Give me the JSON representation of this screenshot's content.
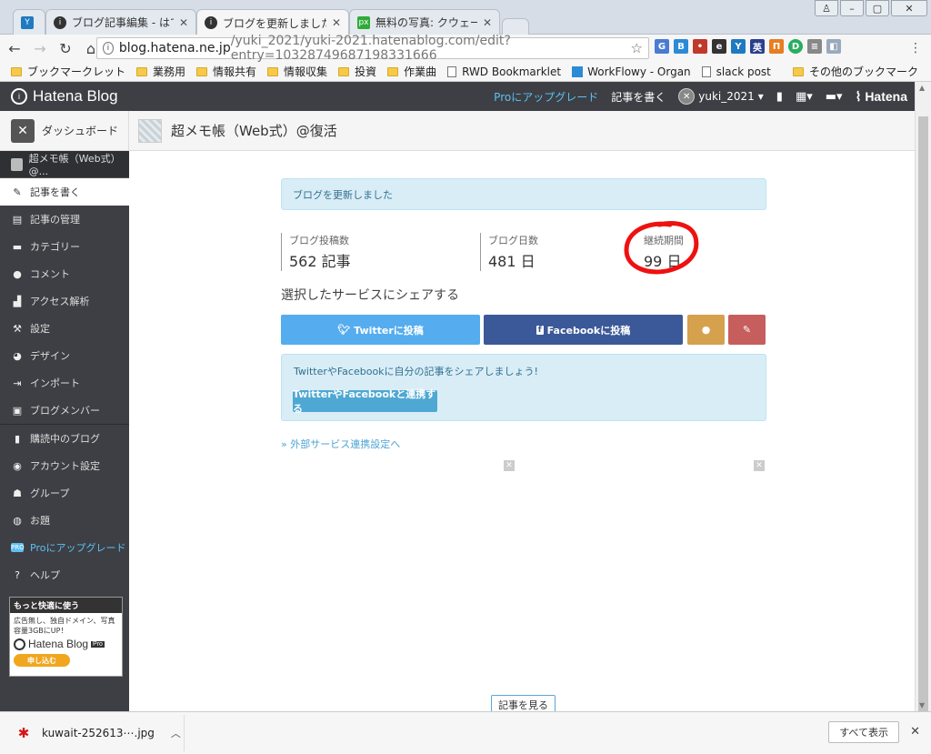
{
  "browser": {
    "tabs": [
      {
        "title": "",
        "icon": "hatena-icon",
        "color": "#1f7ac0"
      },
      {
        "title": "ブログ記事編集 - はてな",
        "icon": "hatena-blog-icon",
        "color": "#333333"
      },
      {
        "title": "ブログを更新しました -",
        "icon": "hatena-blog-icon",
        "color": "#333333"
      },
      {
        "title": "無料の写真: クウェート",
        "icon": "pixabay-icon",
        "color": "#2eab38"
      }
    ],
    "url_host": "blog.hatena.ne.jp",
    "url_path": "/yuki_2021/yuki-2021.hatenablog.com/edit?entry=10328749687198331666",
    "bookmarks": [
      {
        "label": "ブックマークレット",
        "type": "folder"
      },
      {
        "label": "業務用",
        "type": "folder"
      },
      {
        "label": "情報共有",
        "type": "folder"
      },
      {
        "label": "情報収集",
        "type": "folder"
      },
      {
        "label": "投資",
        "type": "folder"
      },
      {
        "label": "作業曲",
        "type": "folder"
      },
      {
        "label": "RWD Bookmarklet",
        "type": "page"
      },
      {
        "label": "WorkFlowy - Organ",
        "type": "workflowy"
      },
      {
        "label": "slack post",
        "type": "page"
      }
    ],
    "bookmarks_other": "その他のブックマーク"
  },
  "hatena_bar": {
    "logo": "Hatena Blog",
    "pro_upgrade": "Proにアップグレード",
    "write_post": "記事を書く",
    "username": "yuki_2021",
    "brand": "Hatena"
  },
  "sub_header": {
    "dashboard": "ダッシュボード",
    "blog_title": "超メモ帳（Web式）@復活"
  },
  "sidebar": {
    "blog_name": "超メモ帳（Web式）@...",
    "items": [
      {
        "label": "記事を書く",
        "icon": "pencil-icon",
        "glyph": "✎",
        "active": true
      },
      {
        "label": "記事の管理",
        "icon": "document-icon",
        "glyph": "▤",
        "active": false
      },
      {
        "label": "カテゴリー",
        "icon": "folder-icon",
        "glyph": "▬",
        "active": false
      },
      {
        "label": "コメント",
        "icon": "comment-icon",
        "glyph": "●",
        "active": false
      },
      {
        "label": "アクセス解析",
        "icon": "bar-chart-icon",
        "glyph": "▟",
        "active": false
      },
      {
        "label": "設定",
        "icon": "wrench-icon",
        "glyph": "⚒",
        "active": false
      },
      {
        "label": "デザイン",
        "icon": "palette-icon",
        "glyph": "◕",
        "active": false
      },
      {
        "label": "インポート",
        "icon": "import-icon",
        "glyph": "⇥",
        "active": false
      },
      {
        "label": "ブログメンバー",
        "icon": "members-icon",
        "glyph": "▣",
        "active": false
      },
      {
        "label": "購読中のブログ",
        "icon": "bookmark-icon",
        "glyph": "▮",
        "active": false
      },
      {
        "label": "アカウント設定",
        "icon": "account-icon",
        "glyph": "◉",
        "active": false
      },
      {
        "label": "グループ",
        "icon": "group-icon",
        "glyph": "☗",
        "active": false
      },
      {
        "label": "お題",
        "icon": "topic-icon",
        "glyph": "◍",
        "active": false
      },
      {
        "label": "Proにアップグレード",
        "icon": "pro-icon",
        "glyph": "PRO",
        "active": false
      },
      {
        "label": "ヘルプ",
        "icon": "help-icon",
        "glyph": "?",
        "active": false
      }
    ],
    "promo": {
      "heading": "もっと快適に使う",
      "text": "広告無し、独自ドメイン、写真容量3GBにUP！",
      "logo": "Hatena Blog",
      "pro": "Pro",
      "button": "申し込む"
    }
  },
  "main": {
    "notice": "ブログを更新しました",
    "stats": [
      {
        "label": "ブログ投稿数",
        "value": "562 記事"
      },
      {
        "label": "ブログ日数",
        "value": "481 日"
      },
      {
        "label": "継続期間",
        "value": "99 日"
      }
    ],
    "share_heading": "選択したサービスにシェアする",
    "twitter_button": "Twitterに投稿",
    "facebook_button": "Facebookに投稿",
    "share_box_text": "TwitterやFacebookに自分の記事をシェアしましょう!",
    "connect_button": "TwitterやFacebookと連携する",
    "external_link": "» 外部サービス連携設定へ",
    "view_post": "記事を見る"
  },
  "download_bar": {
    "file_name": "kuwait-252613⋯.jpg",
    "show_all": "すべて表示"
  },
  "colors": {
    "twitter": "#55acee",
    "facebook": "#3b5998",
    "annotation_red": "#ee1111",
    "hatena_dark": "#3d3f44"
  }
}
